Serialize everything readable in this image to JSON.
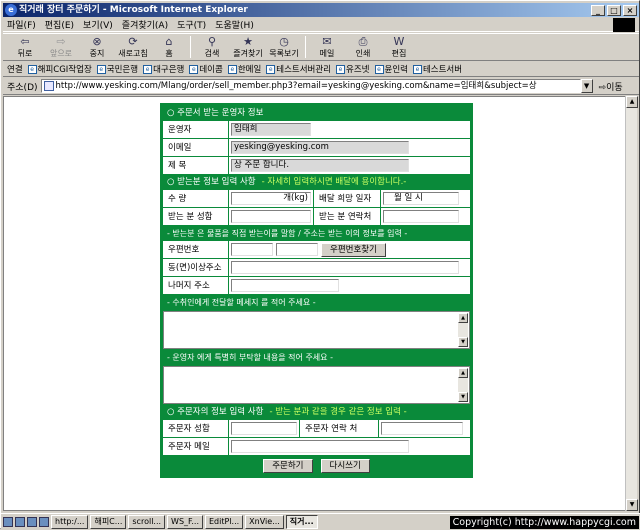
{
  "window": {
    "title": "직거래 장터 주문하기 - Microsoft Internet Explorer",
    "min": "_",
    "max": "□",
    "close": "×"
  },
  "menu": [
    "파일(F)",
    "편집(E)",
    "보기(V)",
    "즐겨찾기(A)",
    "도구(T)",
    "도움말(H)"
  ],
  "toolbar": {
    "back": "뒤로",
    "forward": "앞으로",
    "stop": "중지",
    "refresh": "새로고침",
    "home": "홈",
    "search": "검색",
    "favorites": "즐겨찾기",
    "history": "목록보기",
    "mail": "메일",
    "print": "인쇄",
    "edit": "편집"
  },
  "links": {
    "label": "연결",
    "items": [
      "해피CGI작업장",
      "국민은행",
      "대구은행",
      "데이콤",
      "한메일",
      "테스트서버관리",
      "유즈넷",
      "윤인력",
      "테스트서버"
    ]
  },
  "address": {
    "label": "주소(D)",
    "url": "http://www.yesking.com/Mlang/order/sell_member.php3?email=yesking@yesking.com&name=임태희&subject=상",
    "go": "이동"
  },
  "form": {
    "seller_header": "○ 주문서 받는 운영자 정보",
    "seller_name_label": "운영자",
    "seller_name": "임태희",
    "seller_email_label": "이메일",
    "seller_email": "yesking@yesking.com",
    "subject_label": "제 목",
    "subject": "상 주문 합니다.",
    "recv_header": "○ 받는분 정보 입력 사항",
    "recv_header_note": "- 자세히 입력하시면 배달에 용이합니다.-",
    "qty_label": "수 량",
    "qty_unit": "개(kg)",
    "delivery_label": "배달 희망 일자",
    "delivery_value": "월 일 시",
    "recv_name_label": "받는 분 성함",
    "recv_phone_label": "받는 분 연락처",
    "note1": "- 받는분 은 물품을 직접 받는이를 말함 / 주소는 받는 이의 정보를 입력 -",
    "zip_label": "우편번호",
    "zip_button": "우편번호찾기",
    "addr1_label": "동(면)이상주소",
    "addr2_label": "나머지 주소",
    "note2": "- 수취인에게 전달할 메세지 를 적어 주세요 -",
    "note3": "- 운영자 에게 특별히 부탁할 내용을 적어 주세요 -",
    "orderer_header": "○ 주문자의 정보 입력 사항",
    "orderer_header_note": "- 받는 분과 같을 경우 같은 정보 입력 -",
    "orderer_name_label": "주문자 성함",
    "orderer_phone_label": "주문자 연락 처",
    "orderer_email_label": "주문자 메일",
    "submit": "주문하기",
    "reset": "다시쓰기"
  },
  "taskbar": {
    "tasks": [
      "http:/...",
      "해피C...",
      "scroll...",
      "WS_F...",
      "EditPl...",
      "XnVie...",
      "직거..."
    ]
  },
  "copyright": "Copyright(c) http://www.happycgi.com"
}
